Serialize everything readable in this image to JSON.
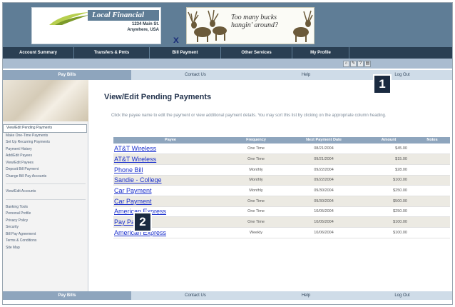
{
  "logo": {
    "name": "Local Financial",
    "address_line1": "1234 Main St.",
    "address_line2": "Anywhere, USA"
  },
  "close_mark": "x",
  "ad": {
    "line1": "Too many bucks",
    "line2": "hangin' around?"
  },
  "nav": {
    "items": [
      {
        "label": "Account Summary"
      },
      {
        "label": "Transfers & Pmts"
      },
      {
        "label": "Bill Payment"
      },
      {
        "label": "Other Services"
      },
      {
        "label": "My Profile"
      }
    ]
  },
  "toolbar_icons": [
    "home-icon",
    "edit-icon",
    "help-icon",
    "print-icon"
  ],
  "tabs": {
    "pay_bills": "Pay Bills",
    "contact_us": "Contact Us",
    "help": "Help",
    "log_out": "Log Out"
  },
  "sidebar": {
    "links_group1": [
      {
        "label": "View/Edit Pending Payments",
        "current": true
      },
      {
        "label": "Make One-Time Payments"
      },
      {
        "label": "Set Up Recurring Payments"
      },
      {
        "label": "Payment History"
      },
      {
        "label": "Add/Edit Payees"
      },
      {
        "label": "View/Edit Payees"
      },
      {
        "label": "Deposit Bill Payment"
      },
      {
        "label": "Change Bill Pay Accounts"
      }
    ],
    "links_group2": [
      {
        "label": "View/Edit Accounts"
      }
    ],
    "links_group3": [
      {
        "label": "Banking Tools"
      },
      {
        "label": "Personal Profile"
      },
      {
        "label": "Privacy Policy"
      },
      {
        "label": "Security"
      },
      {
        "label": "Bill Pay Agreement"
      },
      {
        "label": "Terms & Conditions"
      },
      {
        "label": "Site Map"
      }
    ]
  },
  "main": {
    "title": "View/Edit Pending Payments",
    "instructions": "Click the payee name to edit the payment or view additional payment details. You may sort this list by clicking on the appropriate column heading."
  },
  "table": {
    "headers": [
      "Payee",
      "Frequency",
      "Next Payment Date",
      "Amount",
      "Notes"
    ],
    "rows": [
      {
        "payee": "AT&T Wireless",
        "frequency": "One Time",
        "date": "08/21/2004",
        "amount": "$45.00"
      },
      {
        "payee": "AT&T Wireless",
        "frequency": "One Time",
        "date": "09/21/2004",
        "amount": "$15.00"
      },
      {
        "payee": "Phone Bill",
        "frequency": "Monthly",
        "date": "09/22/2004",
        "amount": "$28.00"
      },
      {
        "payee": "Sandie - College",
        "frequency": "Monthly",
        "date": "09/22/2004",
        "amount": "$100.00"
      },
      {
        "payee": "Car Payment",
        "frequency": "Monthly",
        "date": "09/30/2004",
        "amount": "$250.00"
      },
      {
        "payee": "Car Payment",
        "frequency": "One Time",
        "date": "09/30/2004",
        "amount": "$500.00"
      },
      {
        "payee": "American Express",
        "frequency": "One Time",
        "date": "10/05/2004",
        "amount": "$250.00"
      },
      {
        "payee": "Pay Pal",
        "frequency": "One Time",
        "date": "10/05/2004",
        "amount": "$100.00"
      },
      {
        "payee": "American Express",
        "frequency": "Weekly",
        "date": "10/06/2004",
        "amount": "$100.00"
      }
    ]
  },
  "badges": [
    "1",
    "2"
  ]
}
